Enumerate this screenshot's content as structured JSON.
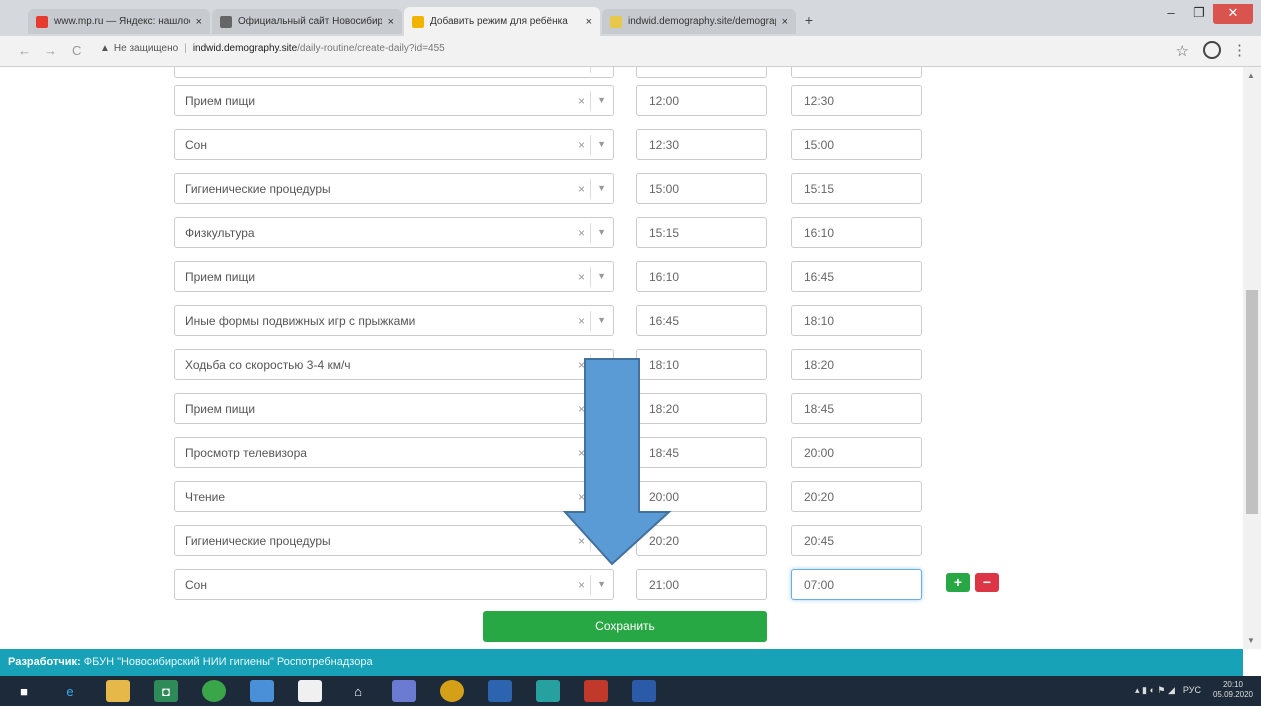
{
  "tabs": [
    {
      "title": "www.mp.ru — Яндекс: нашлось",
      "active": false,
      "favicon_color": "#e63b2e"
    },
    {
      "title": "Официальный сайт Новосибирс",
      "active": false,
      "favicon_color": "#666666"
    },
    {
      "title": "Добавить режим для ребёнка",
      "active": true,
      "favicon_color": "#f0b400"
    },
    {
      "title": "indwid.demography.site/demograph",
      "active": false,
      "favicon_color": "#e8c84a"
    }
  ],
  "window": {
    "minimize": "–",
    "maximize": "❐",
    "close": "✕"
  },
  "address": {
    "back": "←",
    "forward": "→",
    "reload": "C",
    "warning": "Не защищено",
    "host": "indwid.demography.site",
    "path": "/daily-routine/create-daily?id=455",
    "bookmark_icon": "☆",
    "menu_icon": "⋮"
  },
  "rows": [
    {
      "activity": "",
      "start": "",
      "end": ""
    },
    {
      "activity": "Прием пищи",
      "start": "12:00",
      "end": "12:30"
    },
    {
      "activity": "Сон",
      "start": "12:30",
      "end": "15:00"
    },
    {
      "activity": "Гигиенические процедуры",
      "start": "15:00",
      "end": "15:15"
    },
    {
      "activity": "Физкультура",
      "start": "15:15",
      "end": "16:10"
    },
    {
      "activity": "Прием пищи",
      "start": "16:10",
      "end": "16:45"
    },
    {
      "activity": "Иные формы подвижных игр с прыжками",
      "start": "16:45",
      "end": "18:10"
    },
    {
      "activity": "Ходьба со скоростью 3-4 км/ч",
      "start": "18:10",
      "end": "18:20"
    },
    {
      "activity": "Прием пищи",
      "start": "18:20",
      "end": "18:45"
    },
    {
      "activity": "Просмотр телевизора",
      "start": "18:45",
      "end": "20:00"
    },
    {
      "activity": "Чтение",
      "start": "20:00",
      "end": "20:20"
    },
    {
      "activity": "Гигиенические процедуры",
      "start": "20:20",
      "end": "20:45"
    },
    {
      "activity": "Сон",
      "start": "21:00",
      "end": "07:00"
    }
  ],
  "select_clear": "×",
  "select_arrow": "▼",
  "add_label": "+",
  "remove_label": "−",
  "save_label": "Сохранить",
  "footer": {
    "prefix": "Разработчик:",
    "text": " ФБУН \"Новосибирский НИИ гигиены\" Роспотребнадзора"
  },
  "taskbar": {
    "lang": "РУС",
    "time": "20:10",
    "date": "05.09.2020"
  },
  "colors": {
    "accent_green": "#28a745",
    "accent_red": "#dc3545",
    "footer_teal": "#17a2b8",
    "arrow_fill": "#5b9bd5",
    "arrow_stroke": "#41719c"
  }
}
